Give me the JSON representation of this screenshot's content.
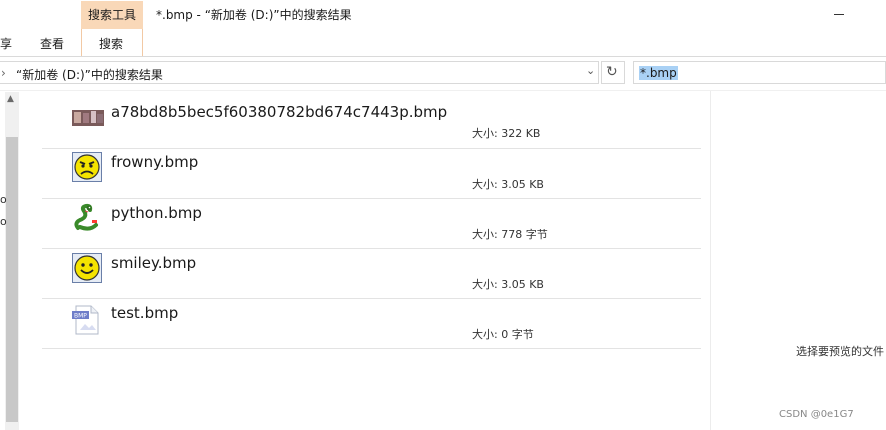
{
  "window": {
    "context_header": "搜索工具",
    "title": "*.bmp - “新加卷 (D:)”中的搜索结果"
  },
  "ribbon": {
    "tabs": [
      "享",
      "查看",
      "搜索"
    ]
  },
  "address_bar": {
    "path": "“新加卷 (D:)”中的搜索结果",
    "prefix_glyph": "›",
    "refresh_icon": "refresh-icon"
  },
  "search": {
    "value": "*.bmp"
  },
  "nav_pane": {
    "glyphs": [
      "o",
      "o"
    ]
  },
  "files": [
    {
      "name": "a78bd8b5bec5f60380782bd674c7443p.bmp",
      "size": "大小: 322 KB",
      "icon": "photo-thumbnail-icon"
    },
    {
      "name": "frowny.bmp",
      "size": "大小: 3.05 KB",
      "icon": "frowny-face-icon"
    },
    {
      "name": "python.bmp",
      "size": "大小: 778 字节",
      "icon": "python-snake-icon"
    },
    {
      "name": "smiley.bmp",
      "size": "大小: 3.05 KB",
      "icon": "smiley-face-icon"
    },
    {
      "name": "test.bmp",
      "size": "大小: 0 字节",
      "icon": "bmp-file-icon"
    }
  ],
  "preview": {
    "text": "选择要预览的文件"
  },
  "watermark": "CSDN @0e1G7",
  "colors": {
    "context_tab": "#f9d8b8",
    "search_highlight": "#a9d1f5",
    "face_yellow": "#f5e400"
  }
}
